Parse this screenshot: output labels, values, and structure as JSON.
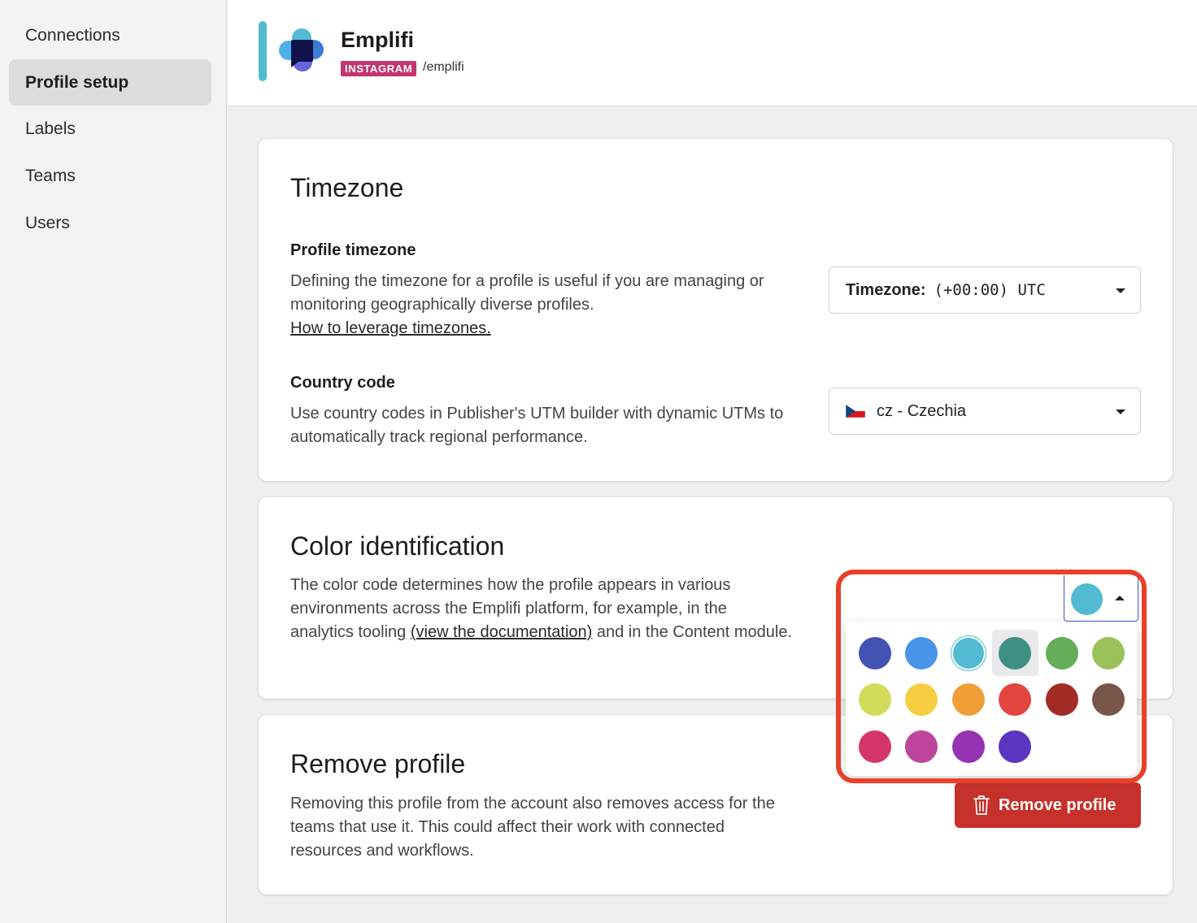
{
  "sidebar": {
    "items": [
      {
        "label": "Connections",
        "active": false
      },
      {
        "label": "Profile setup",
        "active": true
      },
      {
        "label": "Labels",
        "active": false
      },
      {
        "label": "Teams",
        "active": false
      },
      {
        "label": "Users",
        "active": false
      }
    ]
  },
  "header": {
    "profile_name": "Emplifi",
    "platform": "INSTAGRAM",
    "handle": "/emplifi",
    "accent_color": "#52bad1",
    "platform_color": "#c23570"
  },
  "timezone": {
    "title": "Timezone",
    "profile_timezone": {
      "title": "Profile timezone",
      "description": "Defining the timezone for a profile is useful if you are managing or monitoring geographically diverse profiles.",
      "link": "How to leverage timezones.",
      "select_label": "Timezone:",
      "select_value": "(+00:00) UTC"
    },
    "country_code": {
      "title": "Country code",
      "description": "Use country codes in Publisher's UTM builder with dynamic UTMs to automatically track regional performance.",
      "select_value": "cz - Czechia",
      "flag_icon": "czech-flag-icon"
    }
  },
  "color_identification": {
    "title": "Color identification",
    "description_part1": "The color code determines how the profile appears in various environments across the Emplifi platform, for example, in the analytics tooling ",
    "link": "(view the documentation)",
    "description_part2": " and in the Content module.",
    "current_color": "#52bad1",
    "palette": [
      [
        "#4353b3",
        "#4895ea",
        "#52bad1",
        "#3e9182",
        "#65ad59",
        "#9bc25a"
      ],
      [
        "#d3dc5a",
        "#f7cd42",
        "#f29e38",
        "#e2463f",
        "#a32b25",
        "#775649"
      ],
      [
        "#d4366b",
        "#bd459c",
        "#9532b2",
        "#5b35c0"
      ]
    ],
    "selected_color": "#52bad1",
    "hovered_color": "#3e9182"
  },
  "remove_profile": {
    "title": "Remove profile",
    "description": "Removing this profile from the account also removes access for the teams that use it. This could affect their work with connected resources and workflows.",
    "button_label": "Remove profile",
    "button_icon": "trash-icon",
    "button_color": "#c7312b"
  },
  "highlight_color": "#e8402b"
}
